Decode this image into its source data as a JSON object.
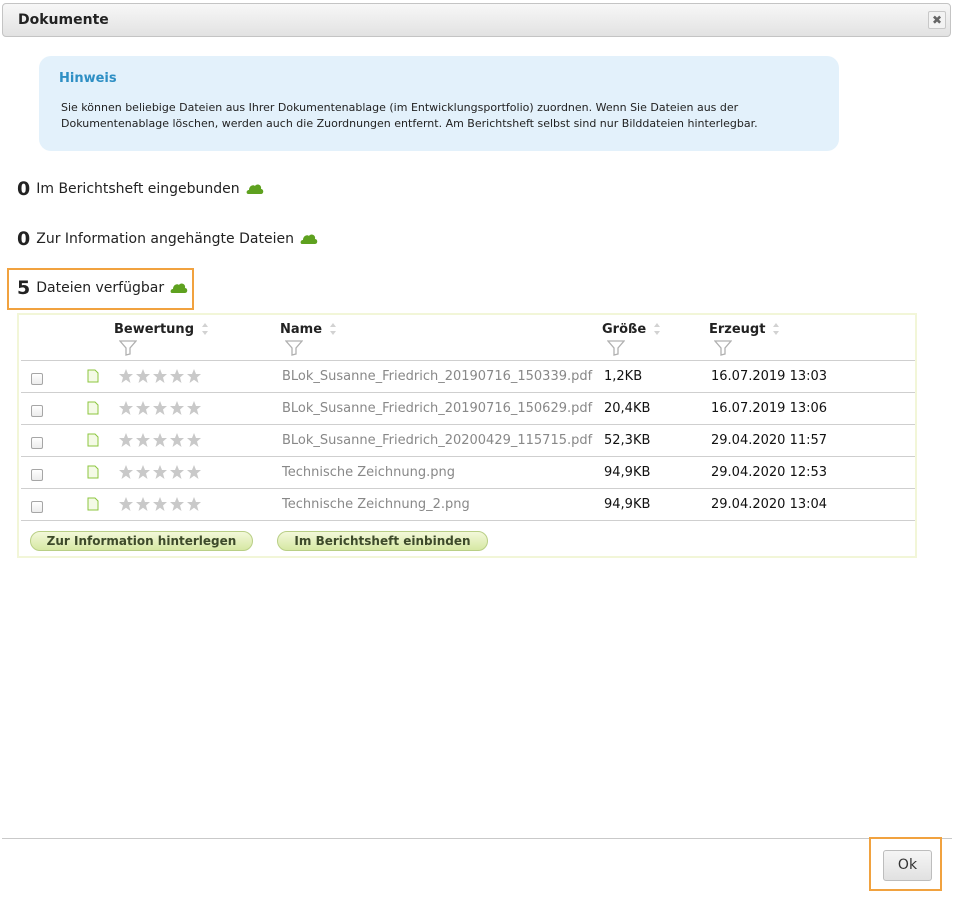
{
  "dialog": {
    "title": "Dokumente",
    "close_icon": "close-icon"
  },
  "hint": {
    "title": "Hinweis",
    "text": "Sie können beliebige Dateien aus Ihrer Dokumentenablage (im Entwicklungsportfolio) zuordnen. Wenn Sie Dateien aus der Dokumentenablage löschen, werden auch die Zuordnungen entfernt. Am Berichtsheft selbst sind nur Bilddateien hinterlegbar."
  },
  "sections": [
    {
      "count": "0",
      "label": "Im Berichtsheft eingebunden",
      "icon": "cloud-up-icon"
    },
    {
      "count": "0",
      "label": "Zur Information angehängte Dateien",
      "icon": "cloud-up-icon"
    },
    {
      "count": "5",
      "label": "Dateien verfügbar",
      "icon": "cloud-up-icon"
    }
  ],
  "table": {
    "columns": {
      "rating": "Bewertung",
      "name": "Name",
      "size": "Größe",
      "created": "Erzeugt"
    },
    "rows": [
      {
        "name": "BLok_Susanne_Friedrich_20190716_150339.pdf",
        "size": "1,2KB",
        "created": "16.07.2019 13:03",
        "rating": 0
      },
      {
        "name": "BLok_Susanne_Friedrich_20190716_150629.pdf",
        "size": "20,4KB",
        "created": "16.07.2019 13:06",
        "rating": 0
      },
      {
        "name": "BLok_Susanne_Friedrich_20200429_115715.pdf",
        "size": "52,3KB",
        "created": "29.04.2020 11:57",
        "rating": 0
      },
      {
        "name": "Technische Zeichnung.png",
        "size": "94,9KB",
        "created": "29.04.2020 12:53",
        "rating": 0
      },
      {
        "name": "Technische Zeichnung_2.png",
        "size": "94,9KB",
        "created": "29.04.2020 13:04",
        "rating": 0
      }
    ]
  },
  "actions": {
    "attach_info": "Zur Information hinterlegen",
    "embed": "Im Berichtsheft einbinden"
  },
  "footer": {
    "ok": "Ok"
  },
  "colors": {
    "accent_orange": "#f1a23f",
    "cloud_green": "#5ea11f",
    "hint_bg": "#e3f1fb",
    "hint_title": "#2e8fc4"
  }
}
